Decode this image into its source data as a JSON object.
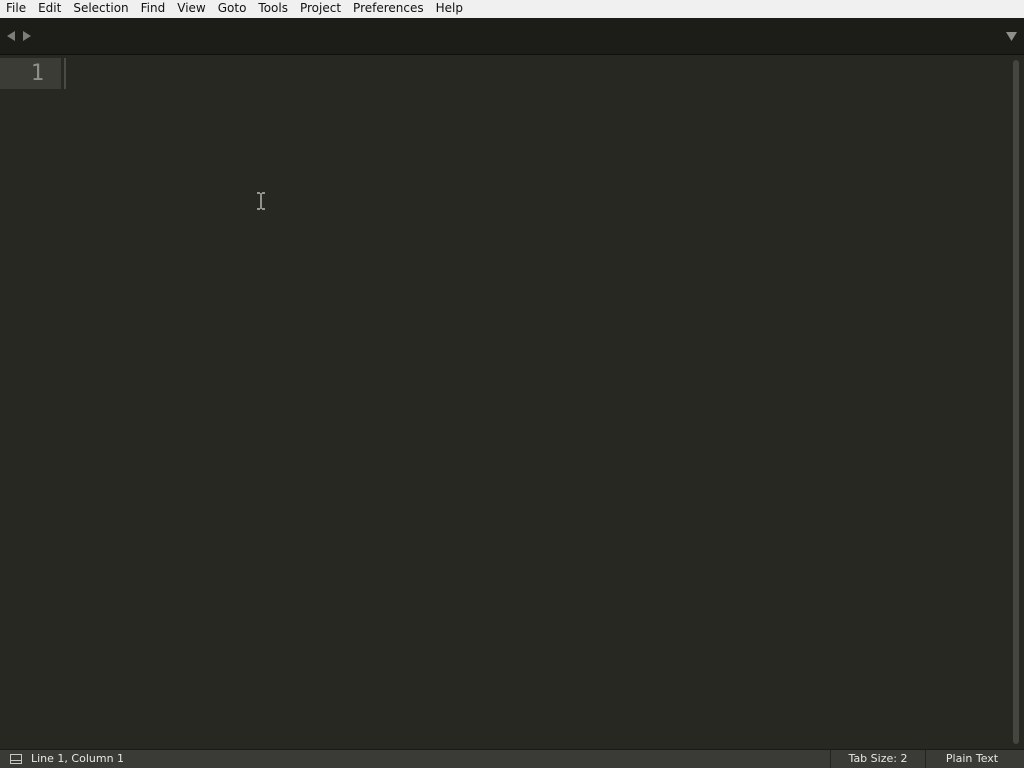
{
  "menubar": {
    "items": [
      {
        "label": "File"
      },
      {
        "label": "Edit"
      },
      {
        "label": "Selection"
      },
      {
        "label": "Find"
      },
      {
        "label": "View"
      },
      {
        "label": "Goto"
      },
      {
        "label": "Tools"
      },
      {
        "label": "Project"
      },
      {
        "label": "Preferences"
      },
      {
        "label": "Help"
      }
    ]
  },
  "tabstrip": {
    "prev_icon": "triangle-left-icon",
    "next_icon": "triangle-right-icon",
    "dropdown_icon": "triangle-down-icon"
  },
  "editor": {
    "line_numbers": [
      "1"
    ],
    "content": ""
  },
  "statusbar": {
    "panel_icon": "panel-toggle-icon",
    "position": "Line 1, Column 1",
    "tab_size": "Tab Size: 2",
    "syntax": "Plain Text"
  },
  "colors": {
    "editor_bg": "#272822",
    "tabstrip_bg": "#1c1d19",
    "statusbar_bg": "#3a3b36",
    "menubar_bg": "#f0f0f0",
    "line_highlight": "#3b3c35",
    "line_number_fg": "#8f908a"
  }
}
